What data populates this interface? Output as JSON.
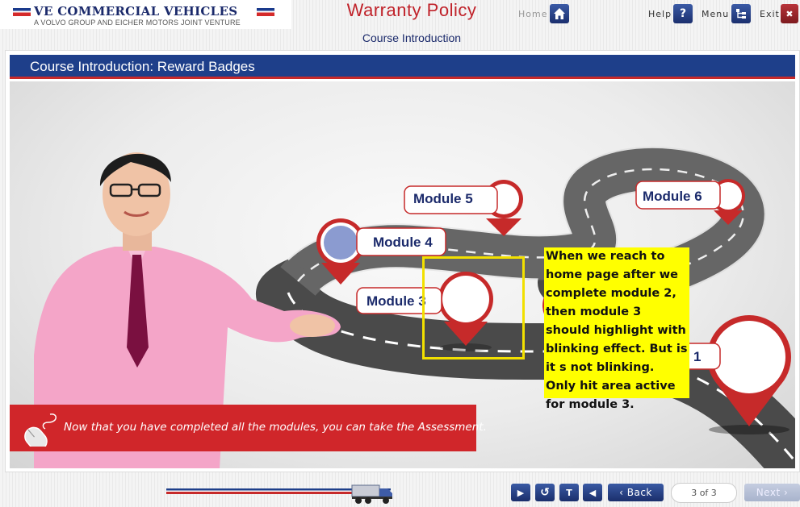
{
  "header": {
    "brand_name": "VE COMMERCIAL VEHICLES",
    "brand_tagline": "A VOLVO GROUP AND EICHER MOTORS JOINT VENTURE",
    "course_title": "Warranty Policy",
    "section_title": "Course Introduction",
    "home_label": "Home",
    "help_label": "Help",
    "help_glyph": "?",
    "menu_label": "Menu",
    "exit_label": "Exit",
    "exit_glyph": "✖"
  },
  "panel": {
    "title": "Course Introduction: Reward Badges"
  },
  "modules": [
    {
      "label": "Module 5"
    },
    {
      "label": "Module 6"
    },
    {
      "label": "Module 4"
    },
    {
      "label": "Module 3"
    },
    {
      "label": "1"
    }
  ],
  "annotation": {
    "text": "When we reach to home page after we complete module 2, then module 3 should highlight with blinking effect. But is it s not blinking. Only hit area active for module 3."
  },
  "message": {
    "text": "Now that you have completed all the modules, you can take the Assessment."
  },
  "footer": {
    "play_glyph": "▶",
    "replay_glyph": "↺",
    "transcript_glyph": "T",
    "audio_glyph": "◀",
    "back_label": "‹ Back",
    "page_indicator": "3 of 3",
    "next_label": "Next ›"
  },
  "colors": {
    "brand_blue": "#1e3f8a",
    "brand_red": "#c62a2a",
    "annotation_yellow": "#ffff00"
  }
}
